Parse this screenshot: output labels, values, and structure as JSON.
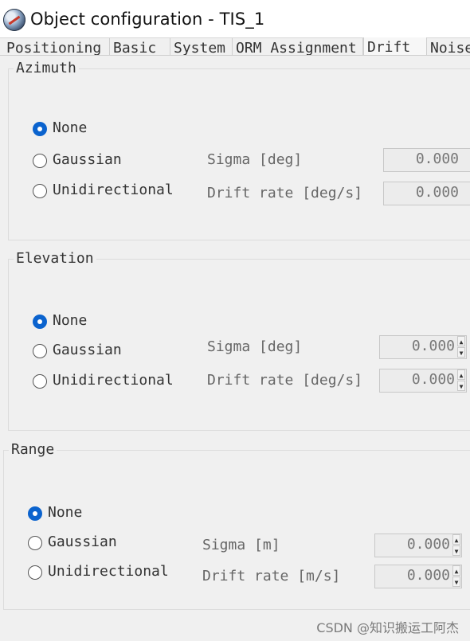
{
  "window": {
    "title": "Object configuration - TIS_1"
  },
  "tabs": [
    {
      "label": "Positioning"
    },
    {
      "label": "Basic"
    },
    {
      "label": "System"
    },
    {
      "label": "ORM Assignment"
    },
    {
      "label": "Drift"
    },
    {
      "label": "Noise"
    }
  ],
  "azimuth": {
    "title": "Azimuth",
    "opt_none": "None",
    "opt_gaussian": "Gaussian",
    "opt_unidirectional": "Unidirectional",
    "sigma_label": "Sigma [deg]",
    "drift_label": "Drift rate [deg/s]",
    "sigma_value": "0.000",
    "drift_value": "0.000",
    "selected": "None"
  },
  "elevation": {
    "title": "Elevation",
    "opt_none": "None",
    "opt_gaussian": "Gaussian",
    "opt_unidirectional": "Unidirectional",
    "sigma_label": "Sigma [deg]",
    "drift_label": "Drift rate [deg/s]",
    "sigma_value": "0.000",
    "drift_value": "0.000",
    "selected": "None"
  },
  "range": {
    "title": "Range",
    "opt_none": "None",
    "opt_gaussian": "Gaussian",
    "opt_unidirectional": "Unidirectional",
    "sigma_label": "Sigma [m]",
    "drift_label": "Drift rate [m/s]",
    "sigma_value": "0.000",
    "drift_value": "0.000",
    "selected": "None"
  },
  "watermark": "CSDN @知识搬运工阿杰",
  "colors": {
    "accent": "#0b63ce",
    "background": "#f0f0f0"
  },
  "icons": {
    "app": "satellite-globe-icon",
    "spin_up": "spin-up-arrow",
    "spin_down": "spin-down-arrow"
  }
}
